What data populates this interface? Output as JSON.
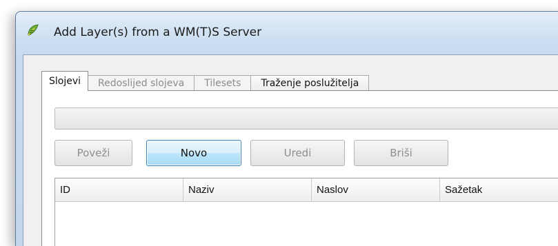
{
  "window": {
    "title": "Add Layer(s) from a WM(T)S Server",
    "icon": "qgis-leaf-icon"
  },
  "tabs": [
    {
      "label": "Slojevi",
      "state": "active"
    },
    {
      "label": "Redoslijed slojeva",
      "state": "disabled"
    },
    {
      "label": "Tilesets",
      "state": "disabled"
    },
    {
      "label": "Traženje poslužitelja",
      "state": "enabled"
    }
  ],
  "connection": {
    "selected": ""
  },
  "buttons": {
    "connect": "Poveži",
    "new": "Novo",
    "edit": "Uredi",
    "delete": "Briši"
  },
  "table": {
    "columns": [
      "ID",
      "Naziv",
      "Naslov",
      "Sažetak"
    ],
    "rows": []
  },
  "colors": {
    "title_bar": "#cddff2",
    "accent_button": "#bee6fd",
    "disabled_text": "#8e8e8e"
  }
}
